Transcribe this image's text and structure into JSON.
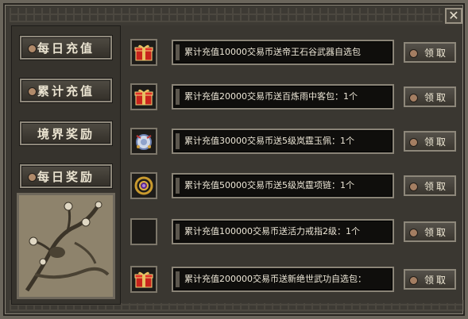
{
  "window": {
    "close_label": "✕"
  },
  "nav": [
    {
      "label": "每日充值"
    },
    {
      "label": "累计充值"
    },
    {
      "label": "境界奖励"
    },
    {
      "label": "每日奖励"
    }
  ],
  "rewards": [
    {
      "icon": "gift-box-icon",
      "text": "累计充值10000交易币送帝王石谷武器自选包",
      "button": "领取"
    },
    {
      "icon": "gift-box-icon",
      "text": "累计充值20000交易币送百炼雨中客包：1个",
      "button": "领取"
    },
    {
      "icon": "jade-pendant-icon",
      "text": "累计充值30000交易币送5级岚霆玉佩：1个",
      "button": "领取"
    },
    {
      "icon": "necklace-icon",
      "text": "累计充值50000交易币送5级岚霆项链：1个",
      "button": "领取"
    },
    {
      "icon": "empty-slot-icon",
      "text": "累计充值100000交易币送活力戒指2级：1个",
      "button": "领取"
    },
    {
      "icon": "gift-box-icon",
      "text": "累计充值200000交易币送新绝世武功自选包：",
      "button": "领取"
    }
  ],
  "colors": {
    "accent": "#8a8477",
    "text": "#ece6d6",
    "gift_red": "#c8241c",
    "gift_gold": "#e8c060"
  }
}
